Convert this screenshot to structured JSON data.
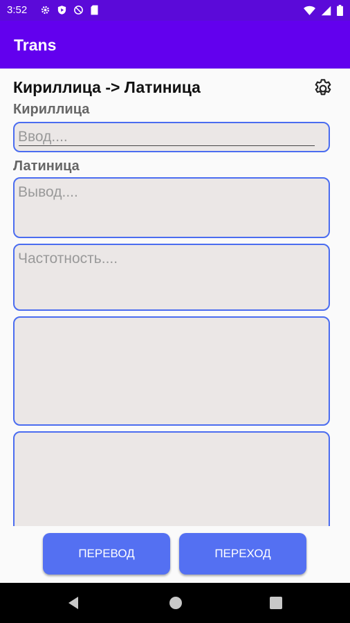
{
  "status_bar": {
    "time": "3:52",
    "left_icons": [
      "gear-icon",
      "shield-play-icon",
      "no-sync-icon",
      "sd-card-icon"
    ],
    "right_icons": [
      "wifi-icon",
      "signal-icon",
      "battery-icon"
    ]
  },
  "app_bar": {
    "title": "Trans"
  },
  "main": {
    "mode_title": "Кириллица -> Латиница",
    "settings_icon": "gear-icon",
    "input_label": "Кириллица",
    "input_placeholder": "Ввод....",
    "output_label": "Латиница",
    "output_placeholder": "Вывод....",
    "frequency_placeholder": "Частотность....",
    "empty_box_1": "",
    "empty_box_2": ""
  },
  "buttons": {
    "translate_label": "ПЕРЕВОД",
    "transition_label": "ПЕРЕХОД"
  },
  "nav": {
    "back": "back-icon",
    "home": "home-icon",
    "recents": "recents-icon"
  },
  "colors": {
    "status_bar": "#5b0ad9",
    "app_bar": "#6200ee",
    "field_bg": "#ebe7e6",
    "field_border": "#4a6cf0",
    "button": "#5470f2"
  }
}
